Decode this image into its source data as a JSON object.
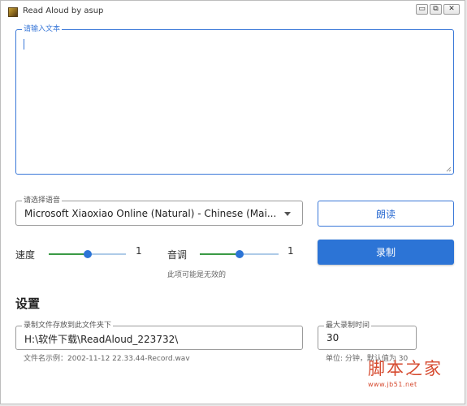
{
  "window": {
    "title": "Read Aloud by asup",
    "controls": {
      "minimize": "▭",
      "maximize": "⧉",
      "close": "✕"
    }
  },
  "text_input": {
    "legend": "请输入文本",
    "value": "",
    "accent_color": "#3a78d8"
  },
  "voice": {
    "legend": "请选择语音",
    "selected": "Microsoft Xiaoxiao Online (Natural) - Chinese (Mai..."
  },
  "buttons": {
    "read_label": "朗读",
    "record_label": "录制",
    "primary_color": "#2c74d6"
  },
  "speed": {
    "label": "速度",
    "value": "1",
    "level": 0.5
  },
  "pitch": {
    "label": "音调",
    "value": "1",
    "level": 0.5
  },
  "pitch_hint": "此项可能是无效的",
  "settings": {
    "title": "设置",
    "save_path": {
      "legend": "录制文件存放到此文件夹下",
      "value": "H:\\软件下载\\ReadAloud_223732\\",
      "hint": "文件名示例：2002-11-12 22.33.44-Record.wav"
    },
    "max_time": {
      "legend": "最大录制时间",
      "value": "30",
      "hint": "单位: 分钟，默认值为 30"
    }
  },
  "watermark": {
    "text": "脚本之家",
    "url": "www.jb51.net"
  },
  "icons": {
    "app": "app-icon",
    "dropdown": "chevron-down-icon",
    "resize": "resize-grip-icon"
  }
}
